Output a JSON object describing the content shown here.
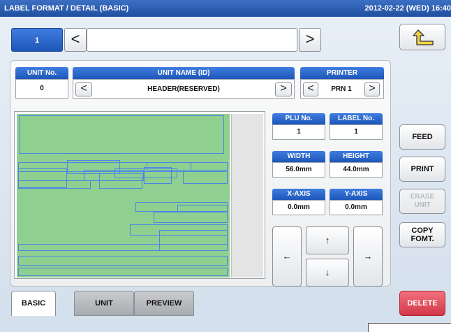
{
  "titlebar": {
    "title": "LABEL FORMAT / DETAIL (BASIC)",
    "datetime": "2012-02-22 (WED) 16:40"
  },
  "page_nav": {
    "number": "1",
    "prev_glyph": "<",
    "next_glyph": ">",
    "field_value": ""
  },
  "unit": {
    "unit_no_label": "UNIT No.",
    "unit_no_value": "0",
    "unit_name_label": "UNIT NAME (ID)",
    "unit_name_value": "HEADER(RESERVED)",
    "printer_label": "PRINTER",
    "printer_value": "PRN 1"
  },
  "fields": {
    "plu_label": "PLU No.",
    "plu_value": "1",
    "label_no_label": "LABEL No.",
    "label_no_value": "1",
    "width_label": "WIDTH",
    "width_value": "56.0mm",
    "height_label": "HEIGHT",
    "height_value": "44.0mm",
    "xaxis_label": "X-AXIS",
    "xaxis_value": "0.0mm",
    "yaxis_label": "Y-AXIS",
    "yaxis_value": "0.0mm"
  },
  "arrows": {
    "left": "←",
    "up": "↑",
    "down": "↓",
    "right": "→"
  },
  "side_buttons": {
    "feed": "FEED",
    "print": "PRINT",
    "erase_line1": "ERASE",
    "erase_line2": "UNIT",
    "copy_line1": "COPY",
    "copy_line2": "FOMT.",
    "delete": "DELETE"
  },
  "tabs": {
    "basic": "BASIC",
    "unit": "UNIT",
    "preview": "PREVIEW"
  },
  "colors": {
    "accent_blue": "#1d56b8",
    "label_area_green": "#8fcf8f",
    "field_border_blue": "#4a86e8",
    "delete_red": "#d23848"
  },
  "icons": {
    "back": "return-arrow-icon"
  }
}
